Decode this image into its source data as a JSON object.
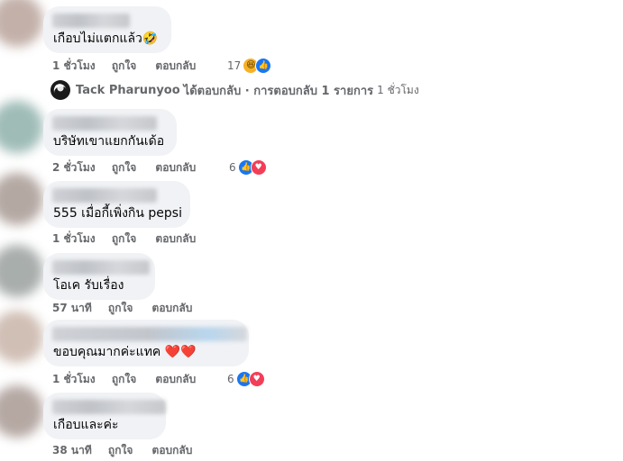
{
  "comments": [
    {
      "text": "เกือบไม่แตกแล้ว🤣",
      "time": "1 ชั่วโมง",
      "like_label": "ถูกใจ",
      "reply_label": "ตอบกลับ",
      "reaction_count": "17",
      "reactions": [
        "haha",
        "like"
      ]
    },
    {
      "text": "บริษัทเขาแยกกันเด้อ",
      "time": "2 ชั่วโมง",
      "like_label": "ถูกใจ",
      "reply_label": "ตอบกลับ",
      "reaction_count": "6",
      "reactions": [
        "like",
        "love"
      ]
    },
    {
      "text": "555 เมื่อกี้เพิ่งกิน pepsi",
      "time": "1 ชั่วโมง",
      "like_label": "ถูกใจ",
      "reply_label": "ตอบกลับ"
    },
    {
      "text": "โอเค รับเรื่อง",
      "time": "57 นาที",
      "like_label": "ถูกใจ",
      "reply_label": "ตอบกลับ"
    },
    {
      "text": "ขอบคุณมากค่ะแทค ",
      "text_suffix": "❤️❤️",
      "time": "1 ชั่วโมง",
      "like_label": "ถูกใจ",
      "reply_label": "ตอบกลับ",
      "reaction_count": "6",
      "reactions": [
        "like",
        "love"
      ]
    },
    {
      "text": "เกือบและค่ะ",
      "time": "38 นาที",
      "like_label": "ถูกใจ",
      "reply_label": "ตอบกลับ"
    }
  ],
  "reply_summary": {
    "author": "Tack Pharunyoo",
    "text": "ได้ตอบกลับ · การตอบกลับ 1 รายการ",
    "time": "1 ชั่วโมง"
  },
  "colors": {
    "bubble": "#f0f2f5",
    "meta_text": "#65676b",
    "like_blue": "#1877f2",
    "love_red": "#f33e58",
    "haha_yellow": "#f7b125"
  },
  "icons": {
    "like_reaction": "thumbs-up-icon",
    "love_reaction": "heart-icon",
    "haha_reaction": "laughing-face-icon",
    "reply_avatar": "profile-avatar"
  }
}
